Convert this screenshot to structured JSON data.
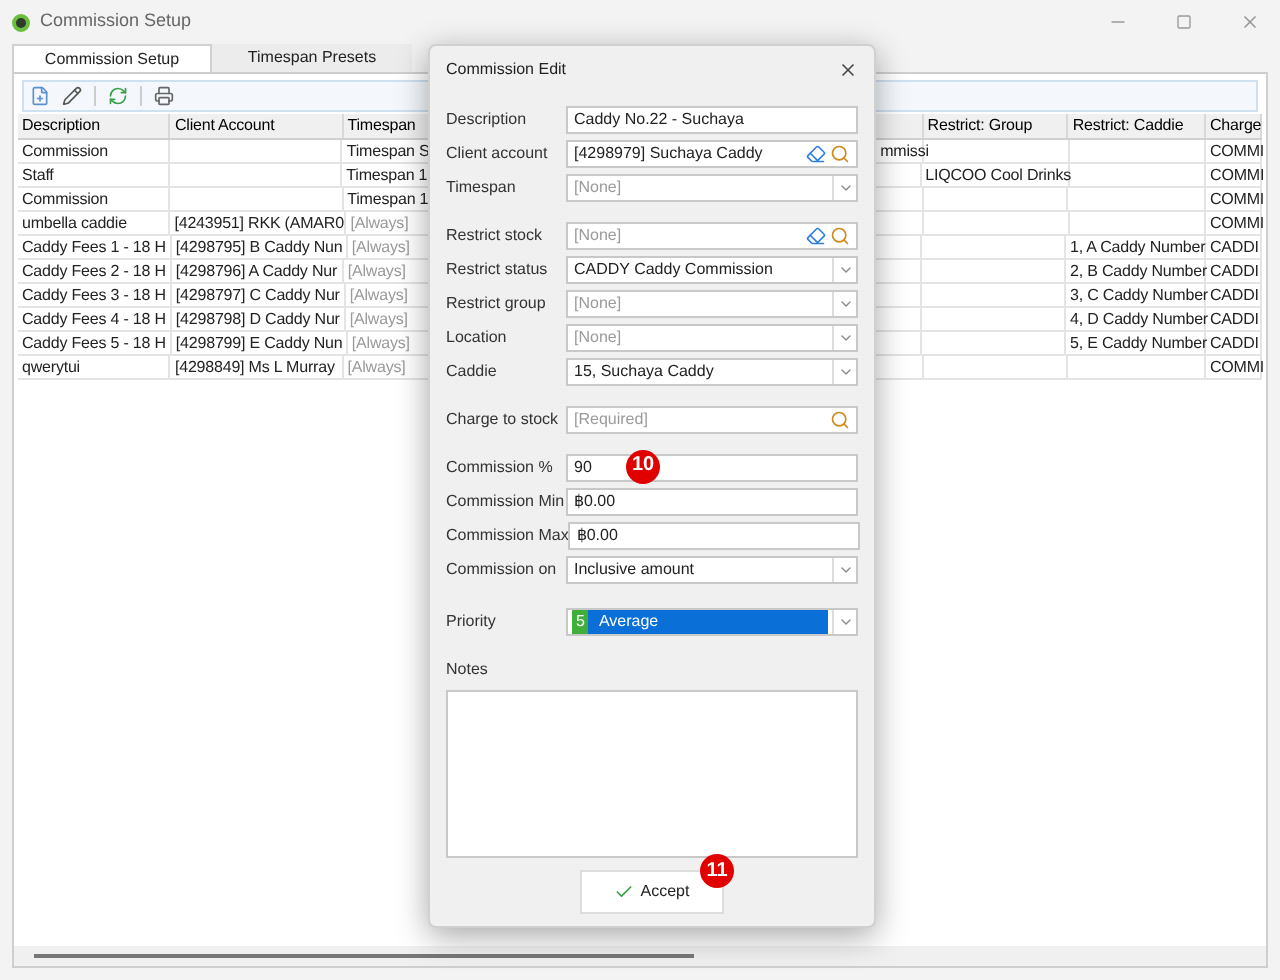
{
  "window": {
    "title": "Commission Setup"
  },
  "tabs": [
    {
      "label": "Commission Setup",
      "selected": true
    },
    {
      "label": "Timespan Presets",
      "selected": false
    }
  ],
  "table": {
    "columns": [
      "Description",
      "Client Account",
      "Timespan",
      null,
      "Restrict: Group",
      "Restrict: Caddie",
      "Charge"
    ],
    "rows": [
      {
        "cells": [
          "Commission",
          null,
          {
            "text": "Timespan S",
            "muted": false
          },
          "mmissi",
          null,
          null,
          "COMMI"
        ]
      },
      {
        "cells": [
          "Staff",
          null,
          {
            "text": "Timespan 1",
            "muted": false
          },
          null,
          "LIQCOO Cool Drinks",
          null,
          "COMMI"
        ]
      },
      {
        "cells": [
          "Commission",
          null,
          {
            "text": "Timespan 1",
            "muted": false
          },
          null,
          null,
          null,
          "COMMI"
        ]
      },
      {
        "cells": [
          "umbella caddie",
          "[4243951] RKK (AMAR0",
          {
            "text": "[Always]",
            "muted": true
          },
          null,
          null,
          null,
          "COMMI"
        ]
      },
      {
        "cells": [
          "Caddy Fees 1 - 18 H",
          "[4298795] B Caddy Nun",
          {
            "text": "[Always]",
            "muted": true
          },
          null,
          null,
          "1, A Caddy Number",
          "CADDI"
        ]
      },
      {
        "cells": [
          "Caddy Fees 2 - 18 H",
          "[4298796] A Caddy Nur",
          {
            "text": "[Always]",
            "muted": true
          },
          null,
          null,
          "2, B Caddy Number",
          "CADDI"
        ]
      },
      {
        "cells": [
          "Caddy Fees 3 - 18 H",
          "[4298797] C Caddy Nur",
          {
            "text": "[Always]",
            "muted": true
          },
          null,
          null,
          "3, C Caddy Number",
          "CADDI"
        ]
      },
      {
        "cells": [
          "Caddy Fees 4 - 18 H",
          "[4298798] D Caddy Nur",
          {
            "text": "[Always]",
            "muted": true
          },
          null,
          null,
          "4, D Caddy Number",
          "CADDI"
        ]
      },
      {
        "cells": [
          "Caddy Fees 5 - 18 H",
          "[4298799] E Caddy Nun",
          {
            "text": "[Always]",
            "muted": true
          },
          null,
          null,
          "5, E Caddy Number",
          "CADDI"
        ]
      },
      {
        "cells": [
          "qwerytui",
          "[4298849] Ms L Murray",
          {
            "text": "[Always]",
            "muted": true
          },
          null,
          null,
          null,
          "COMMI"
        ]
      }
    ]
  },
  "dialog": {
    "title": "Commission Edit",
    "field_groups": [
      [
        {
          "label": "Description",
          "kind": "text",
          "value": "Caddy No.22 - Suchaya"
        },
        {
          "label": "Client account",
          "kind": "lookup",
          "value": "[4298979] Suchaya Caddy"
        },
        {
          "label": "Timespan",
          "kind": "dropdown",
          "placeholder": "[None]"
        }
      ],
      [
        {
          "label": "Restrict stock",
          "kind": "lookup",
          "placeholder": "[None]"
        },
        {
          "label": "Restrict status",
          "kind": "dropdown",
          "value": "CADDY Caddy Commission"
        },
        {
          "label": "Restrict group",
          "kind": "dropdown",
          "placeholder": "[None]"
        },
        {
          "label": "Location",
          "kind": "dropdown",
          "placeholder": "[None]"
        },
        {
          "label": "Caddie",
          "kind": "dropdown",
          "value": "15, Suchaya Caddy"
        }
      ],
      [
        {
          "label": "Charge to stock",
          "kind": "search",
          "placeholder": "[Required]"
        }
      ],
      [
        {
          "label": "Commission %",
          "kind": "text",
          "value": "90",
          "marker": "10"
        },
        {
          "label": "Commission Min",
          "kind": "text",
          "value": "฿0.00"
        },
        {
          "label": "Commission Max",
          "kind": "text",
          "value": "฿0.00"
        },
        {
          "label": "Commission on",
          "kind": "dropdown",
          "value": "Inclusive amount"
        }
      ],
      [
        {
          "label": "Priority",
          "kind": "dropdown",
          "value": "Average",
          "badge": "5",
          "highlighted": true
        }
      ]
    ],
    "notes": {
      "label": "Notes"
    },
    "accept": {
      "label": "Accept",
      "marker": "11"
    }
  }
}
